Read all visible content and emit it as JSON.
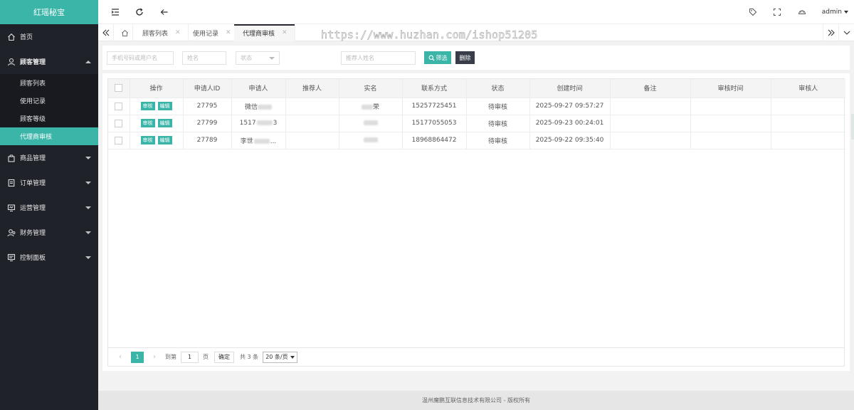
{
  "app": {
    "title": "红瑶秘宝",
    "user": "admin"
  },
  "watermark": "https://www.huzhan.com/ishop51205",
  "sidebar": {
    "home": "首页",
    "groups": [
      {
        "label": "顾客管理",
        "open": true,
        "children": [
          "顾客列表",
          "使用记录",
          "顾客等级",
          "代理商审核"
        ]
      },
      {
        "label": "商品管理"
      },
      {
        "label": "订单管理"
      },
      {
        "label": "运营管理"
      },
      {
        "label": "财务管理"
      },
      {
        "label": "控制面板"
      }
    ]
  },
  "tabs": [
    {
      "label": "顾客列表"
    },
    {
      "label": "使用记录"
    },
    {
      "label": "代理商审核",
      "active": true
    }
  ],
  "filter": {
    "phone_placeholder": "手机号码或用户名",
    "name_placeholder": "姓名",
    "status_placeholder": "状态",
    "referrer_placeholder": "推荐人姓名",
    "search_label": "筛选",
    "delete_label": "删除"
  },
  "table": {
    "headers": [
      "操作",
      "申请人ID",
      "申请人",
      "推荐人",
      "实名",
      "联系方式",
      "状态",
      "创建时间",
      "备注",
      "审核时间",
      "审核人"
    ],
    "action_review": "审核",
    "action_edit": "编辑",
    "rows": [
      {
        "id": "27795",
        "applicant_prefix": "微信",
        "applicant_suffix": "",
        "realname_prefix": "",
        "realname_suffix": "荣",
        "phone": "15257725451",
        "status": "待审核",
        "created": "2025-09-27 09:57:27"
      },
      {
        "id": "27799",
        "applicant_prefix": "1517",
        "applicant_suffix": "3",
        "realname_prefix": "",
        "realname_suffix": "",
        "phone": "15177055053",
        "status": "待审核",
        "created": "2025-09-23 00:24:01"
      },
      {
        "id": "27789",
        "applicant_prefix": "李世",
        "applicant_suffix": "...",
        "realname_prefix": "",
        "realname_suffix": "",
        "phone": "18968864472",
        "status": "待审核",
        "created": "2025-09-22 09:35:40"
      }
    ]
  },
  "pager": {
    "current": "1",
    "goto_label": "到第",
    "goto_value": "1",
    "page_label": "页",
    "confirm": "确定",
    "total": "共 3 条",
    "page_size": "20 条/页"
  },
  "footer": "温州魔鹏互联信息技术有限公司 - 版权所有",
  "colors": {
    "accent": "#3ab5a8",
    "sidebar": "#20222a",
    "dark_button": "#393d49"
  }
}
